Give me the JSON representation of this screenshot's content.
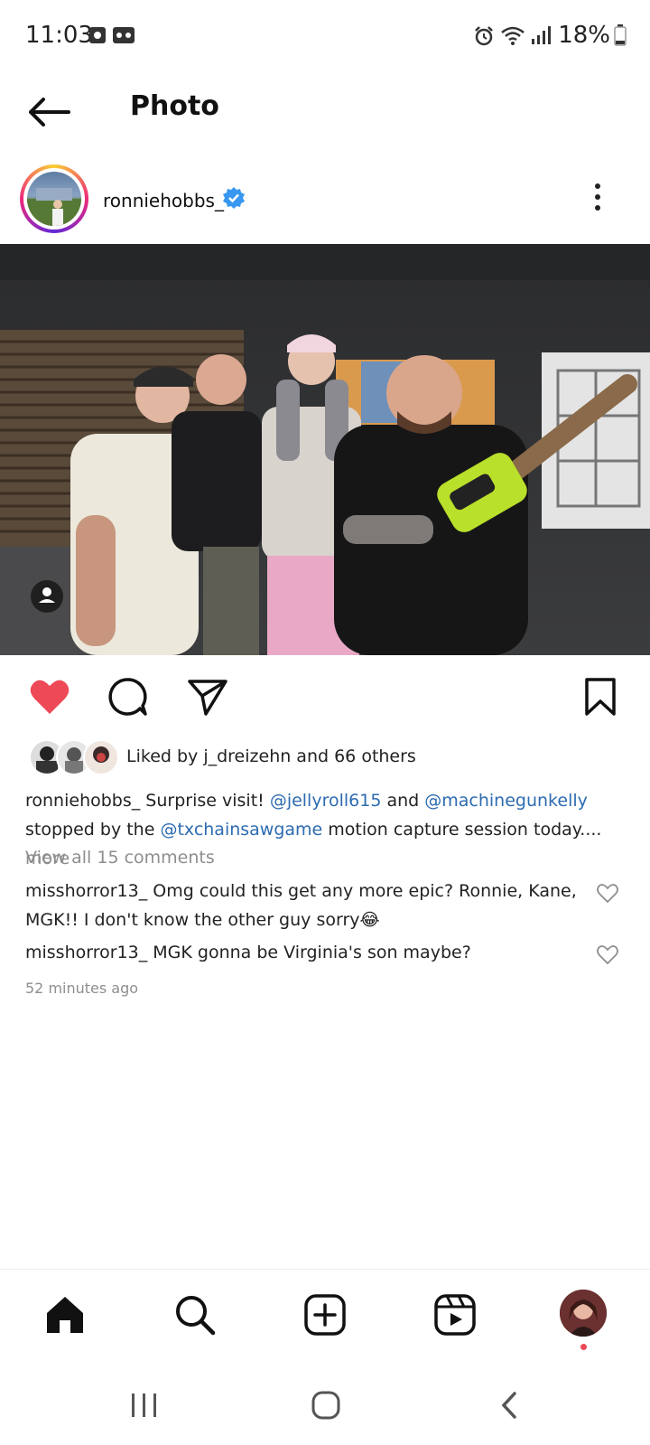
{
  "status_bar": {
    "time": "11:03",
    "battery": "18%"
  },
  "header": {
    "title": "Photo"
  },
  "post": {
    "username": "ronniehobbs_",
    "likes_text": "Liked by j_dreizehn and 66 others",
    "caption": {
      "username": "ronniehobbs_",
      "text1": " Surprise visit! ",
      "mention1": "@jellyroll615",
      "text2": " and ",
      "mention2": "@machinegunkelly",
      "text3": " stopped by the ",
      "mention3": "@txchainsawgame",
      "text4": " motion capture session today....",
      "more": " more"
    },
    "view_all": "View all 15 comments",
    "comments": [
      {
        "username": "misshorror13_",
        "text": " Omg could this get any more epic? Ronnie, Kane, MGK!! I don't know the other guy sorry😂"
      },
      {
        "username": "misshorror13_",
        "text": " MGK gonna be Virginia's son maybe?"
      }
    ],
    "time_ago": "52 minutes ago"
  },
  "colors": {
    "like_red": "#ed4956",
    "link_blue": "#2d6bb0",
    "verified_blue": "#3897f0"
  },
  "icons": {
    "status": [
      "photo-icon",
      "voicemail-icon",
      "alarm-icon",
      "wifi-icon",
      "signal-icon",
      "battery-icon"
    ],
    "nav": [
      "home-icon",
      "search-icon",
      "create-icon",
      "reels-icon",
      "profile-avatar"
    ]
  }
}
